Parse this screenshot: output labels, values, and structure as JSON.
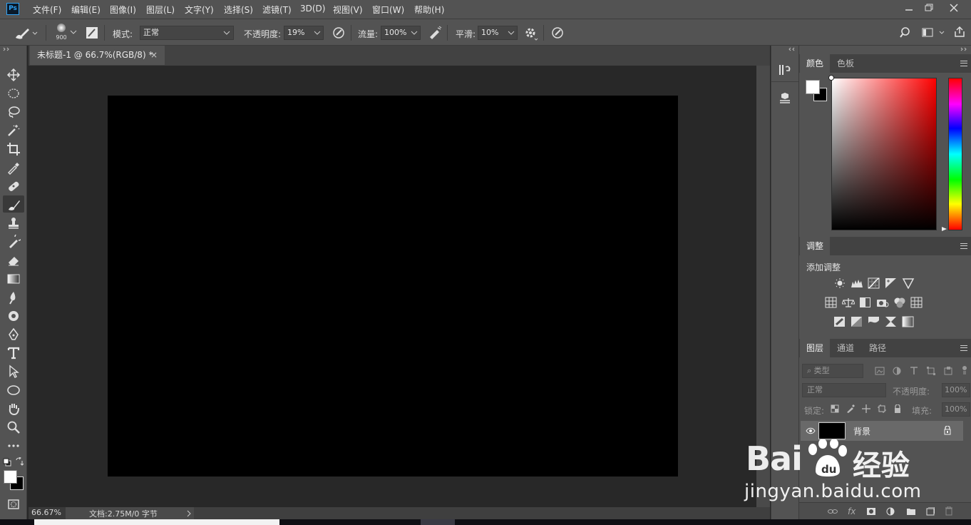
{
  "app": {
    "logo_text": "Ps"
  },
  "menu": [
    "文件(F)",
    "编辑(E)",
    "图像(I)",
    "图层(L)",
    "文字(Y)",
    "选择(S)",
    "滤镜(T)",
    "3D(D)",
    "视图(V)",
    "窗口(W)",
    "帮助(H)"
  ],
  "options": {
    "brush_size": "900",
    "mode_label": "模式:",
    "mode_value": "正常",
    "opacity_label": "不透明度:",
    "opacity_value": "19%",
    "flow_label": "流量:",
    "flow_value": "100%",
    "smooth_label": "平滑:",
    "smooth_value": "10%"
  },
  "document": {
    "tab_title": "未标题-1 @ 66.7%(RGB/8) *",
    "tab_close": "×",
    "zoom": "66.67%",
    "doc_info": "文档:2.75M/0 字节",
    "canvas_color": "#000000"
  },
  "color_panel": {
    "tabs": [
      "颜色",
      "色板"
    ],
    "hue": "#ff0000"
  },
  "adjust_panel": {
    "tabs": [
      "调整"
    ],
    "heading": "添加调整"
  },
  "layers_panel": {
    "tabs": [
      "图层",
      "通道",
      "路径"
    ],
    "filter_placeholder": "类型",
    "blend_mode": "正常",
    "opacity_label": "不透明度:",
    "opacity_value": "100%",
    "lock_label": "锁定:",
    "fill_label": "填充:",
    "fill_value": "100%",
    "layers": [
      {
        "name": "背景",
        "visible": true,
        "locked": true
      }
    ]
  },
  "watermark": {
    "brand": "Bai",
    "brand_suffix": "经验",
    "url": "jingyan.baidu.com"
  }
}
